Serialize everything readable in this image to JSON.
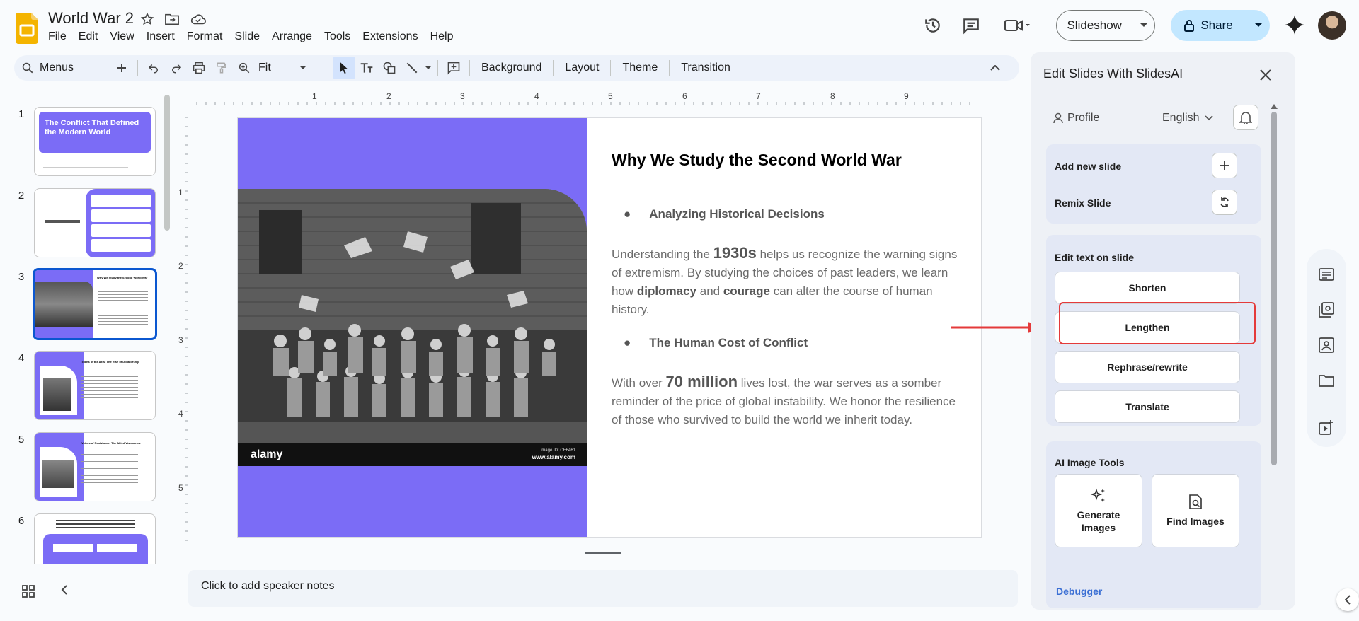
{
  "app": {
    "doc_title": "World War 2",
    "menu": [
      "File",
      "Edit",
      "View",
      "Insert",
      "Format",
      "Slide",
      "Arrange",
      "Tools",
      "Extensions",
      "Help"
    ],
    "slideshow_label": "Slideshow",
    "share_label": "Share"
  },
  "toolbar": {
    "search_label": "Menus",
    "zoom_value": "Fit",
    "background_label": "Background",
    "layout_label": "Layout",
    "theme_label": "Theme",
    "transition_label": "Transition"
  },
  "ruler": {
    "h_ticks": [
      "1",
      "2",
      "3",
      "4",
      "5",
      "6",
      "7",
      "8",
      "9"
    ],
    "v_ticks": [
      "1",
      "2",
      "3",
      "4",
      "5"
    ]
  },
  "filmstrip": {
    "slides": [
      {
        "num": "1",
        "title": "The Conflict That Defined the Modern World"
      },
      {
        "num": "2",
        "title": ""
      },
      {
        "num": "3",
        "title": "Why We Study the Second World War"
      },
      {
        "num": "4",
        "title": "Titans of the Axis: The Rise of Dictatorship"
      },
      {
        "num": "5",
        "title": "Voices of Resistance: The Allied Visionaries"
      },
      {
        "num": "6",
        "title": ""
      }
    ],
    "selected_index": 2
  },
  "slide": {
    "heading": "Why We Study the Second World War",
    "bullet1": "Analyzing Historical Decisions",
    "para1": {
      "a": "Understanding the ",
      "b": "1930s",
      "c": " helps us recognize the warning signs of extremism. By studying the choices of past leaders, we learn how ",
      "d": "diplomacy",
      "e": " and ",
      "f": "courage",
      "g": " can alter the course of human history."
    },
    "bullet2": "The Human Cost of Conflict",
    "para2": {
      "a": "With over ",
      "b": "70 million",
      "c": " lives lost, the war serves as a somber reminder of the price of global instability. We honor the resilience of those who survived to build the world we inherit today."
    },
    "photo_watermark": "alamy",
    "photo_id": "Image ID: CE6461",
    "photo_site": "www.alamy.com"
  },
  "notes_placeholder": "Click to add speaker notes",
  "panel": {
    "title": "Edit Slides With SlidesAI",
    "profile_label": "Profile",
    "language": "English",
    "add_new_slide": "Add new slide",
    "remix_slide": "Remix Slide",
    "edit_text_heading": "Edit text on slide",
    "shorten": "Shorten",
    "lengthen": "Lengthen",
    "rephrase": "Rephrase/rewrite",
    "translate": "Translate",
    "ai_image_heading": "AI Image Tools",
    "generate_images": "Generate Images",
    "find_images": "Find Images",
    "debugger": "Debugger"
  },
  "colors": {
    "slide_accent": "#7b6cf6",
    "highlight": "#e43a3a",
    "share_bg": "#c2e7ff",
    "selected_border": "#0b57d0"
  }
}
